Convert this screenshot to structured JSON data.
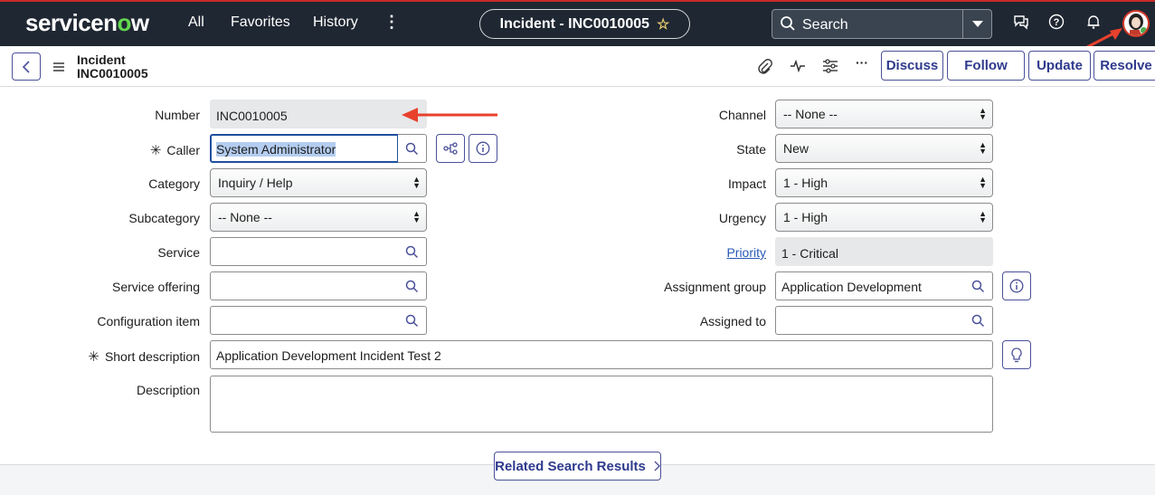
{
  "topbar": {
    "logo_text_a": "servicen",
    "logo_text_o": "o",
    "logo_text_b": "w",
    "nav": [
      "All",
      "Favorites",
      "History"
    ],
    "more": "⋮",
    "context_title": "Incident - INC0010005",
    "search_placeholder": "Search"
  },
  "header": {
    "record_type": "Incident",
    "record_number": "INC0010005",
    "buttons": [
      "Discuss",
      "Follow",
      "Update",
      "Resolve"
    ],
    "more": "···"
  },
  "form": {
    "number_label": "Number",
    "number_value": "INC0010005",
    "caller_label": "Caller",
    "caller_value": "System Administrator",
    "category_label": "Category",
    "category_value": "Inquiry / Help",
    "subcategory_label": "Subcategory",
    "subcategory_value": "-- None --",
    "service_label": "Service",
    "service_value": "",
    "service_offering_label": "Service offering",
    "service_offering_value": "",
    "config_item_label": "Configuration item",
    "config_item_value": "",
    "short_desc_label": "Short description",
    "short_desc_value": "Application Development Incident Test 2",
    "description_label": "Description",
    "description_value": "",
    "channel_label": "Channel",
    "channel_value": "-- None --",
    "state_label": "State",
    "state_value": "New",
    "impact_label": "Impact",
    "impact_value": "1 - High",
    "urgency_label": "Urgency",
    "urgency_value": "1 - High",
    "priority_label": "Priority",
    "priority_value": "1 - Critical",
    "assignment_group_label": "Assignment group",
    "assignment_group_value": "Application Development",
    "assigned_to_label": "Assigned to",
    "assigned_to_value": "",
    "required_mark": "✳"
  },
  "footer": {
    "related_search": "Related Search Results"
  },
  "colors": {
    "topbar": "#1f2732",
    "accent": "#4a5099",
    "annotation": "#e8412c"
  }
}
